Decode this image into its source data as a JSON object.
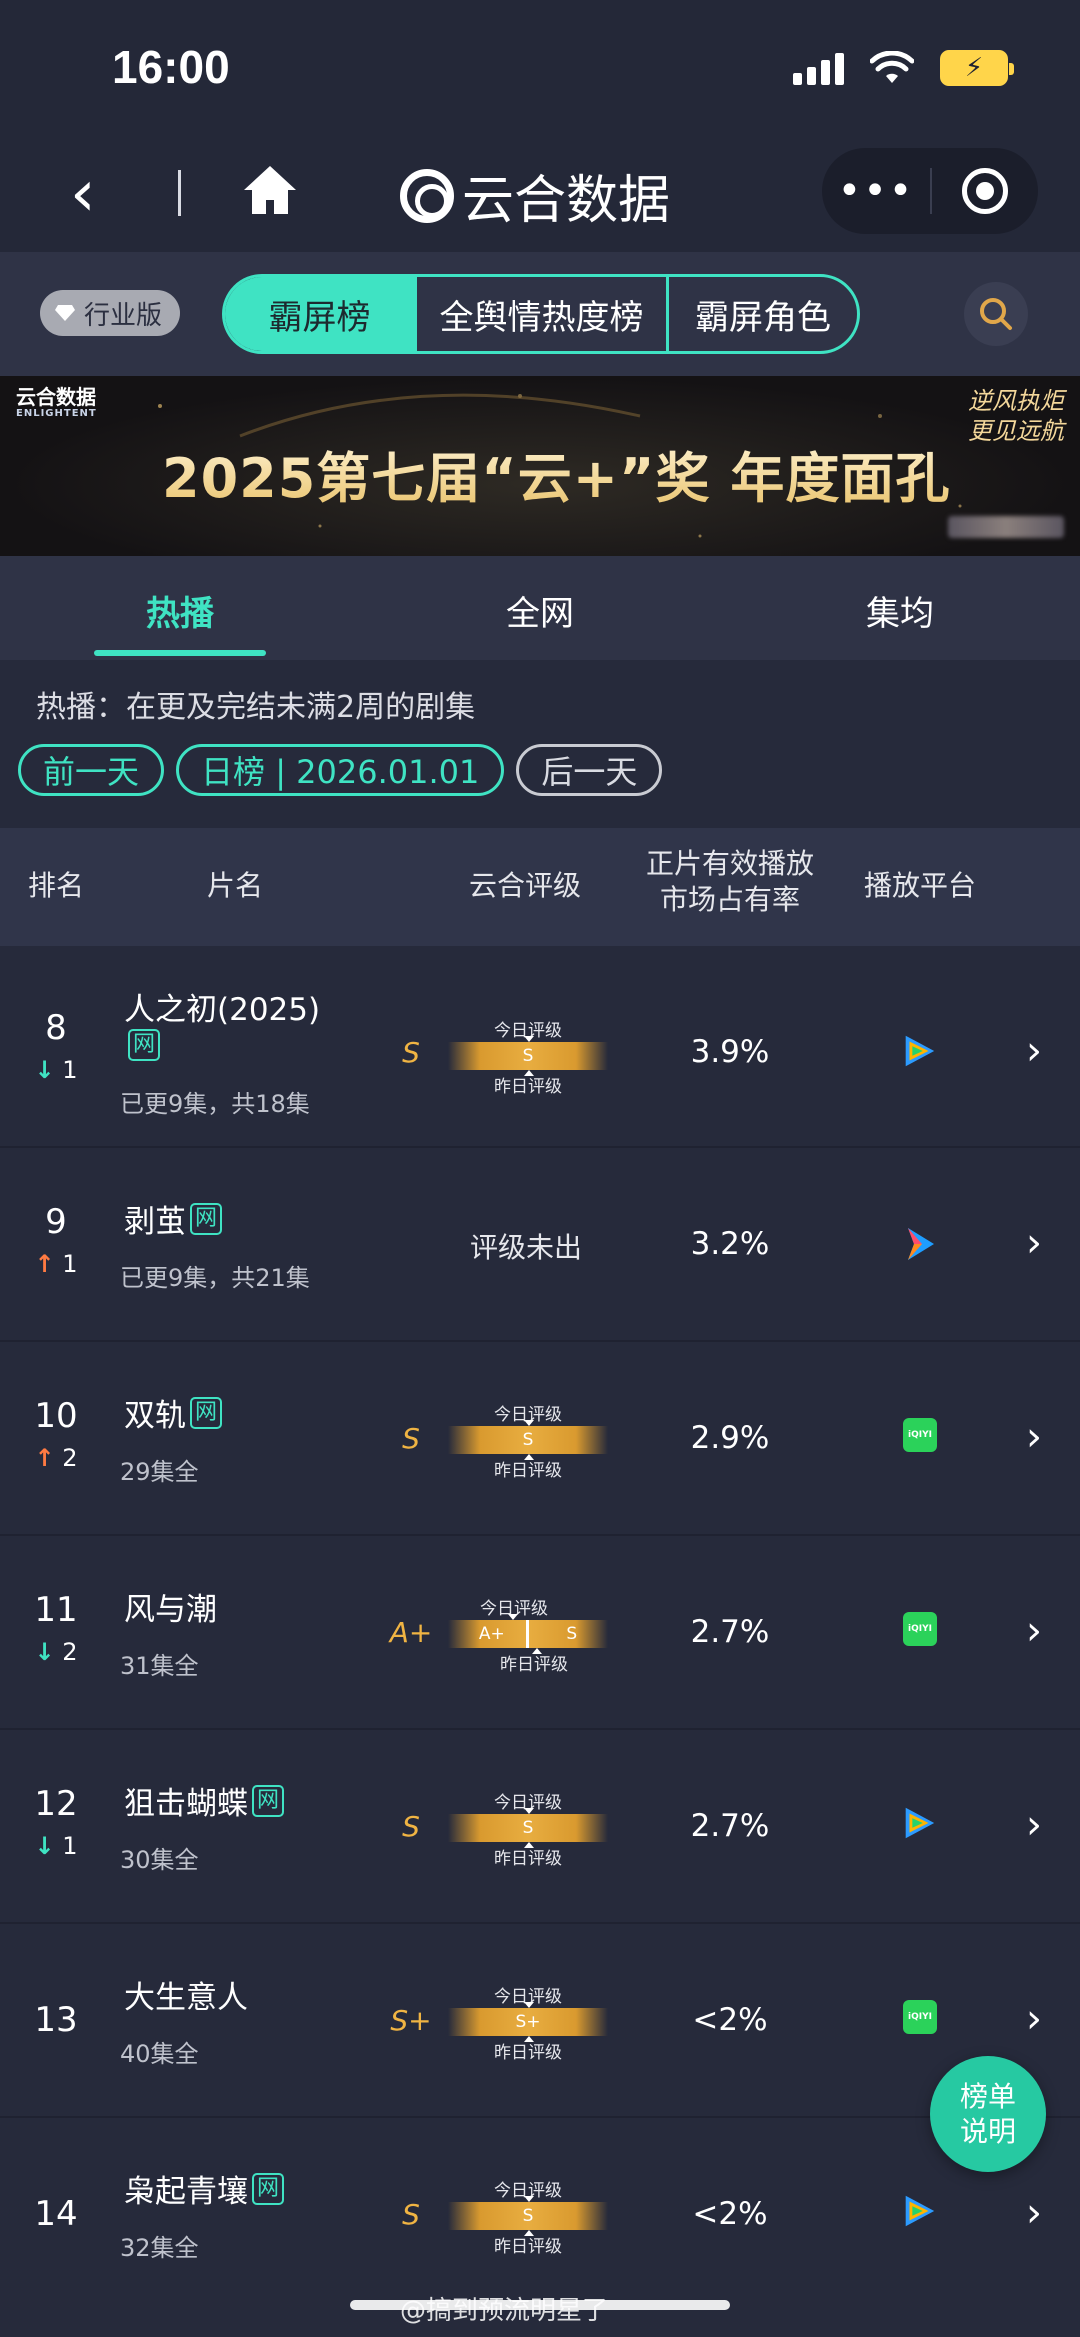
{
  "status_bar": {
    "time": "16:00"
  },
  "nav": {
    "title": "云合数据",
    "more_label": "•••"
  },
  "toolbar": {
    "edition_badge": "行业版",
    "tabs": [
      {
        "label": "霸屏榜",
        "active": true
      },
      {
        "label": "全舆情热度榜",
        "active": false
      },
      {
        "label": "霸屏角色",
        "active": false
      }
    ]
  },
  "banner": {
    "logo_text": "云合数据",
    "logo_sub": "ENLIGHTENT",
    "title": "2025第七届“云+”奖  年度面孔",
    "slogan_line1": "逆风执炬",
    "slogan_line2": "更见远航"
  },
  "main_tabs": [
    {
      "label": "热播",
      "active": true
    },
    {
      "label": "全网",
      "active": false
    },
    {
      "label": "集均",
      "active": false
    }
  ],
  "note": "热播：在更及完结未满2周的剧集",
  "date_controls": {
    "prev": "前一天",
    "current": "日榜 | 2026.01.01",
    "next": "后一天"
  },
  "table_headers": {
    "rank": "排名",
    "title": "片名",
    "rating": "云合评级",
    "share_line1": "正片有效播放",
    "share_line2": "市场占有率",
    "platform": "播放平台"
  },
  "rating_labels": {
    "today": "今日评级",
    "yesterday": "昨日评级"
  },
  "rows": [
    {
      "rank": "8",
      "trend": "↓",
      "trend_type": "down",
      "trend_value": "1",
      "title": "人之初(2025)",
      "tag": "网",
      "episodes": "已更9集，共18集",
      "grade": "S",
      "today": "S",
      "yesterday": "S",
      "share": "3.9%",
      "platform": "tencent"
    },
    {
      "rank": "9",
      "trend": "↑",
      "trend_type": "up",
      "trend_value": "1",
      "title": "剥茧",
      "tag": "网",
      "episodes": "已更9集，共21集",
      "grade": "",
      "not_rated": "评级未出",
      "share": "3.2%",
      "platform": "youku"
    },
    {
      "rank": "10",
      "trend": "↑",
      "trend_type": "up",
      "trend_value": "2",
      "title": "双轨",
      "tag": "网",
      "episodes": "29集全",
      "grade": "S",
      "today": "S",
      "yesterday": "S",
      "share": "2.9%",
      "platform": "iqiyi"
    },
    {
      "rank": "11",
      "trend": "↓",
      "trend_type": "down",
      "trend_value": "2",
      "title": "风与潮",
      "tag": "",
      "episodes": "31集全",
      "grade": "A+",
      "today": "A+",
      "yesterday": "S",
      "share": "2.7%",
      "platform": "iqiyi"
    },
    {
      "rank": "12",
      "trend": "↓",
      "trend_type": "down",
      "trend_value": "1",
      "title": "狙击蝴蝶",
      "tag": "网",
      "episodes": "30集全",
      "grade": "S",
      "today": "S",
      "yesterday": "S",
      "share": "2.7%",
      "platform": "tencent"
    },
    {
      "rank": "13",
      "trend": "",
      "trend_type": "",
      "trend_value": "",
      "title": "大生意人",
      "tag": "",
      "episodes": "40集全",
      "grade": "S+",
      "today": "S+",
      "yesterday": "S+",
      "share": "<2%",
      "platform": "iqiyi"
    },
    {
      "rank": "14",
      "trend": "",
      "trend_type": "",
      "trend_value": "",
      "title": "枭起青壤",
      "tag": "网",
      "episodes": "32集全",
      "grade": "S",
      "today": "S",
      "yesterday": "S",
      "share": "<2%",
      "platform": "tencent"
    }
  ],
  "iqiyi_label": "iQIYI",
  "fab": {
    "line1": "榜单",
    "line2": "说明"
  },
  "footer_watermark": "@搞到预流明星了",
  "colors": {
    "accent": "#3fe3c3",
    "grade": "#f0b443",
    "up": "#ff7a42",
    "background": "#262a3b"
  }
}
